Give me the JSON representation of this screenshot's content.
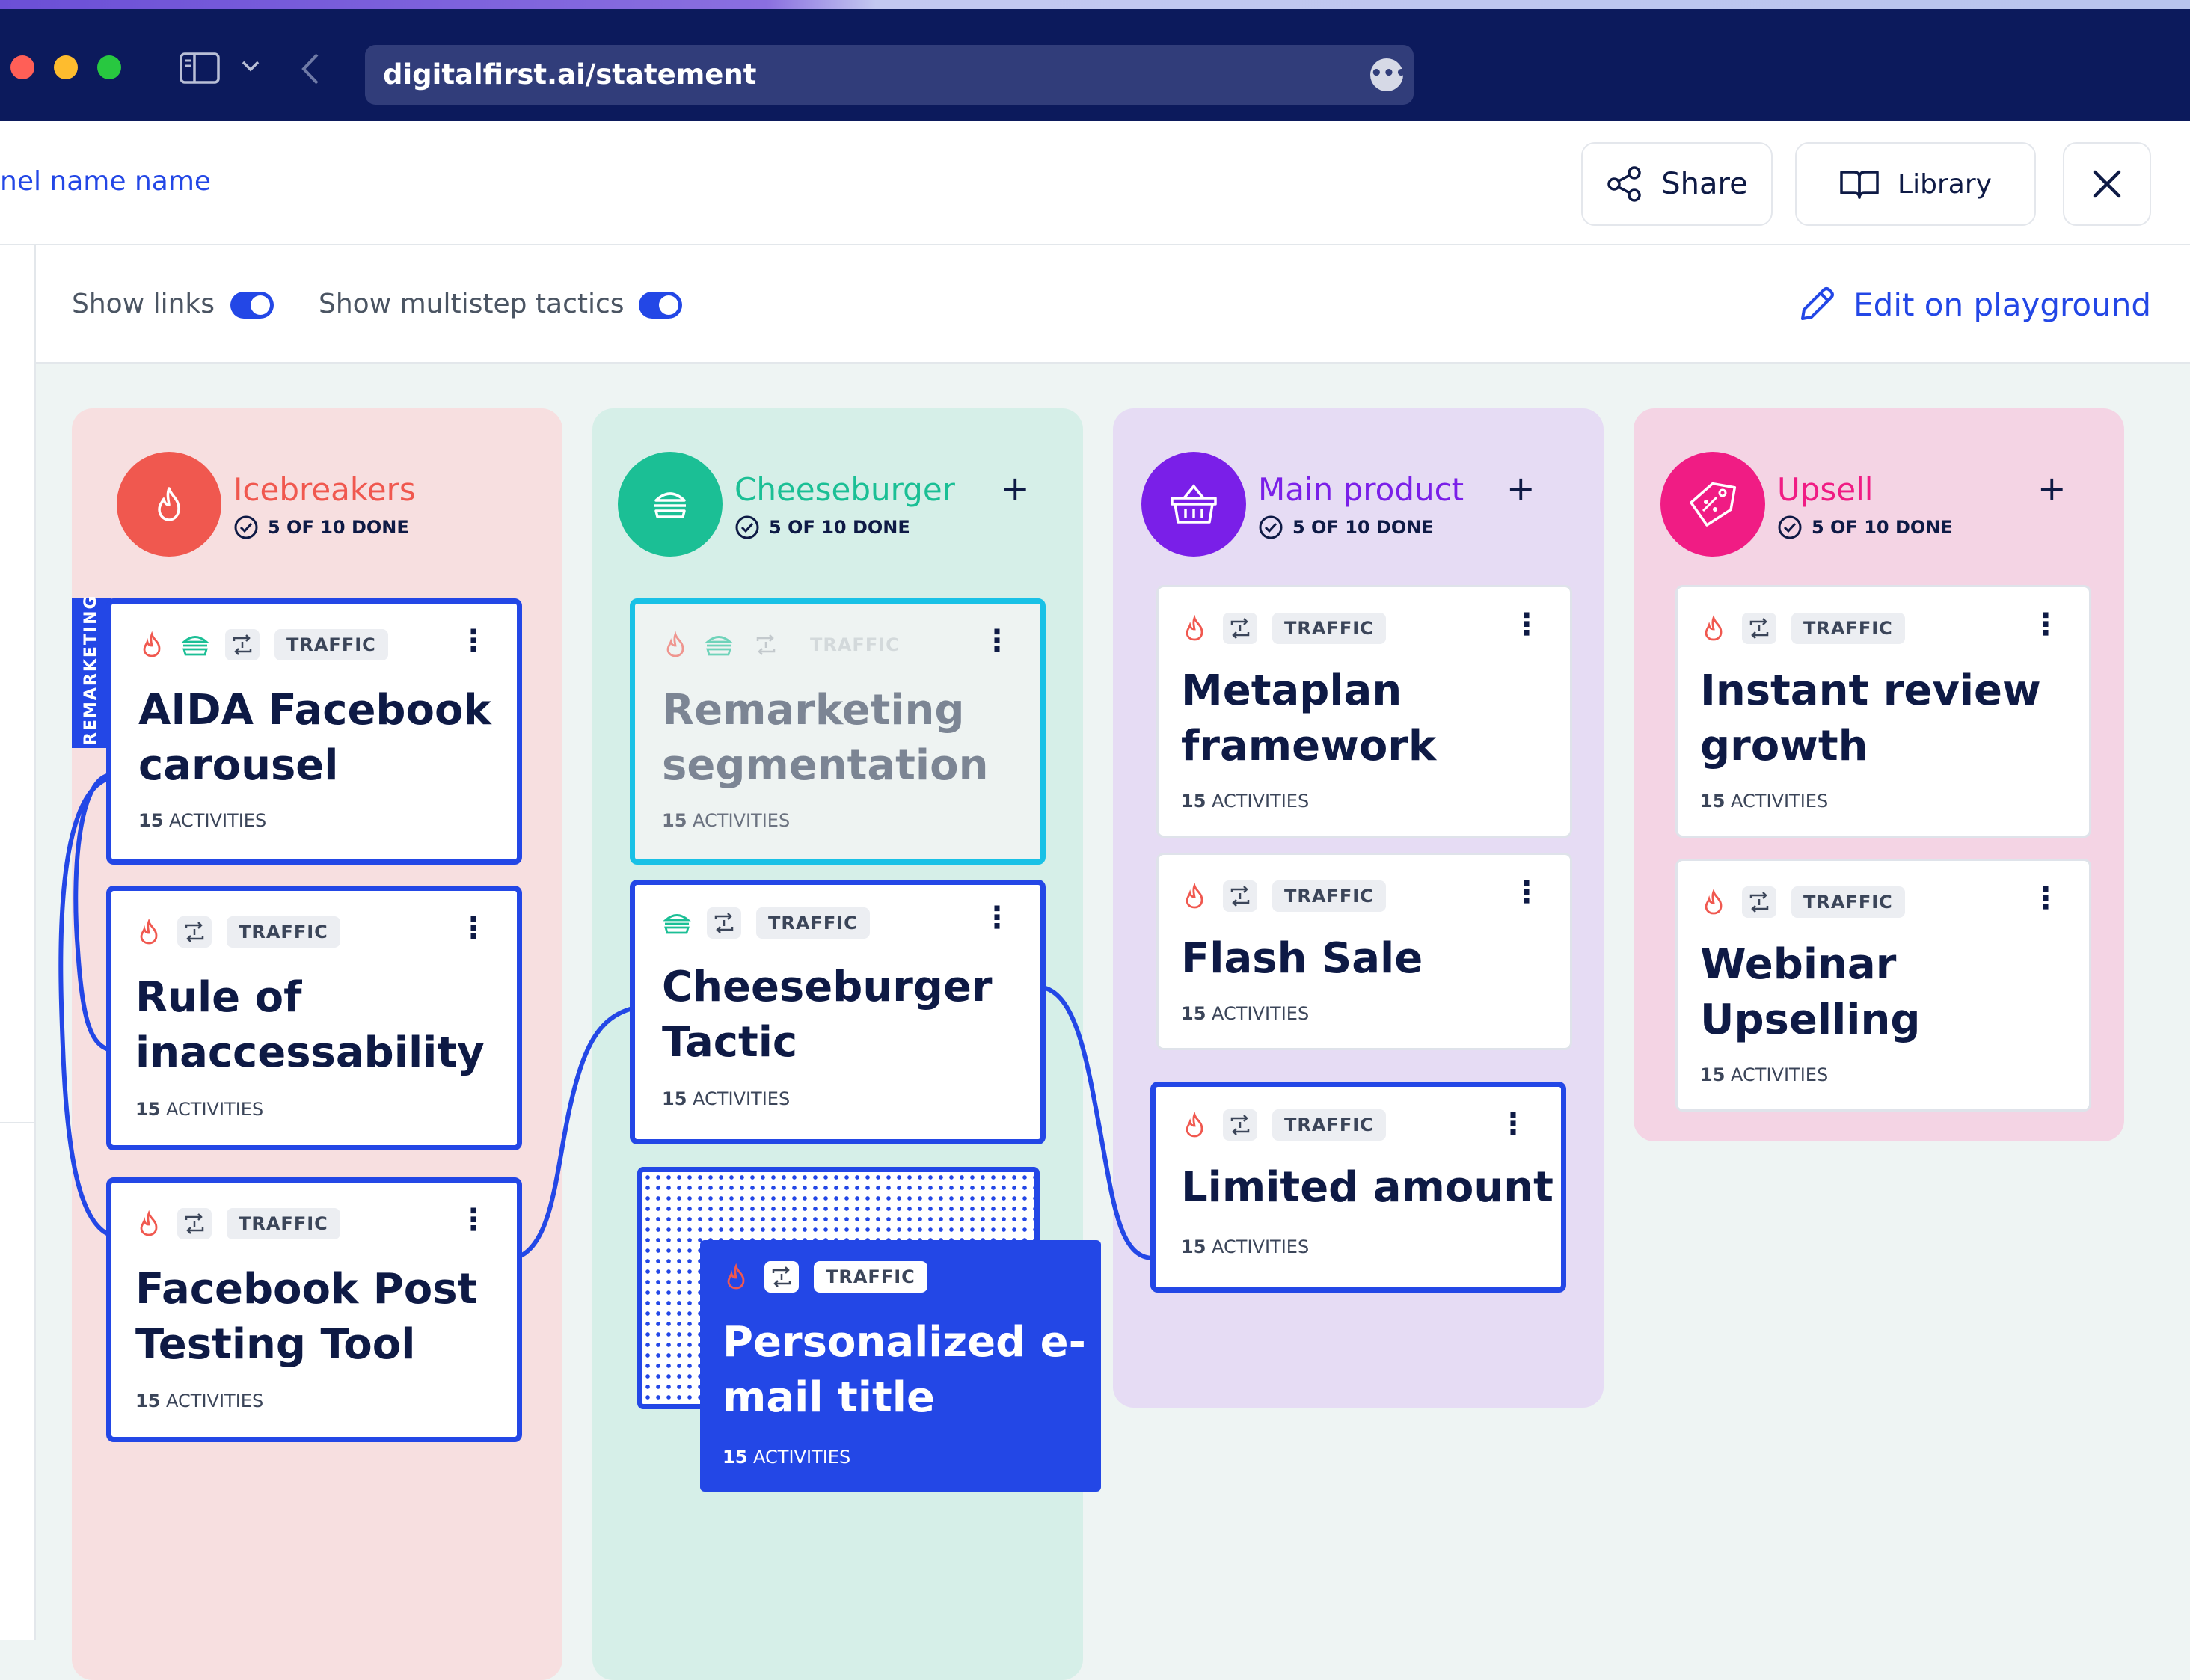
{
  "browser": {
    "url": "digitalfirst.ai/statement",
    "more_icon": "ellipsis-icon",
    "traffic_colors": [
      "#ff5f57",
      "#febc2e",
      "#28c840"
    ]
  },
  "header": {
    "breadcrumb": "nel name name",
    "share_label": "Share",
    "library_label": "Library"
  },
  "toolbar": {
    "show_links_label": "Show links",
    "show_links_on": true,
    "show_multistep_label": "Show multistep tactics",
    "show_multistep_on": true,
    "edit_label": "Edit on playground"
  },
  "colors": {
    "accent": "#2347e6",
    "icebreakers": "#f0584f",
    "cheeseburger": "#1bbf95",
    "main_product": "#7a1fe8",
    "upsell": "#f01c84"
  },
  "columns": [
    {
      "title": "Icebreakers",
      "icon": "flame-icon",
      "done": "5 OF 10 DONE",
      "cards": [
        {
          "title": "AIDA Facebook carousel",
          "tag": "TRAFFIC",
          "count": "15",
          "unit": "ACTIVITIES"
        },
        {
          "title": "Rule of inaccessability",
          "tag": "TRAFFIC",
          "count": "15",
          "unit": "ACTIVITIES"
        },
        {
          "title": "Facebook Post Testing Tool",
          "tag": "TRAFFIC",
          "count": "15",
          "unit": "ACTIVITIES"
        }
      ],
      "side_label": "REMARKETING"
    },
    {
      "title": "Cheeseburger",
      "icon": "burger-icon",
      "done": "5 OF 10 DONE",
      "add_icon": "+",
      "cards": [
        {
          "title": "Remarketing segmentation",
          "tag": "TRAFFIC",
          "count": "15",
          "unit": "ACTIVITIES"
        },
        {
          "title": "Cheeseburger Tactic",
          "tag": "TRAFFIC",
          "count": "15",
          "unit": "ACTIVITIES"
        },
        {
          "title": "Personalized e-mail title",
          "tag": "TRAFFIC",
          "count": "15",
          "unit": "ACTIVITIES"
        }
      ]
    },
    {
      "title": "Main product",
      "icon": "basket-icon",
      "done": "5 OF 10 DONE",
      "add_icon": "+",
      "cards": [
        {
          "title": "Metaplan framework",
          "tag": "TRAFFIC",
          "count": "15",
          "unit": "ACTIVITIES"
        },
        {
          "title": "Flash Sale",
          "tag": "TRAFFIC",
          "count": "15",
          "unit": "ACTIVITIES"
        },
        {
          "title": "Limited amount",
          "tag": "TRAFFIC",
          "count": "15",
          "unit": "ACTIVITIES"
        }
      ]
    },
    {
      "title": "Upsell",
      "icon": "price-tag-icon",
      "done": "5 OF 10 DONE",
      "add_icon": "+",
      "cards": [
        {
          "title": "Instant review growth",
          "tag": "TRAFFIC",
          "count": "15",
          "unit": "ACTIVITIES"
        },
        {
          "title": "Webinar Upselling",
          "tag": "TRAFFIC",
          "count": "15",
          "unit": "ACTIVITIES"
        }
      ]
    }
  ]
}
